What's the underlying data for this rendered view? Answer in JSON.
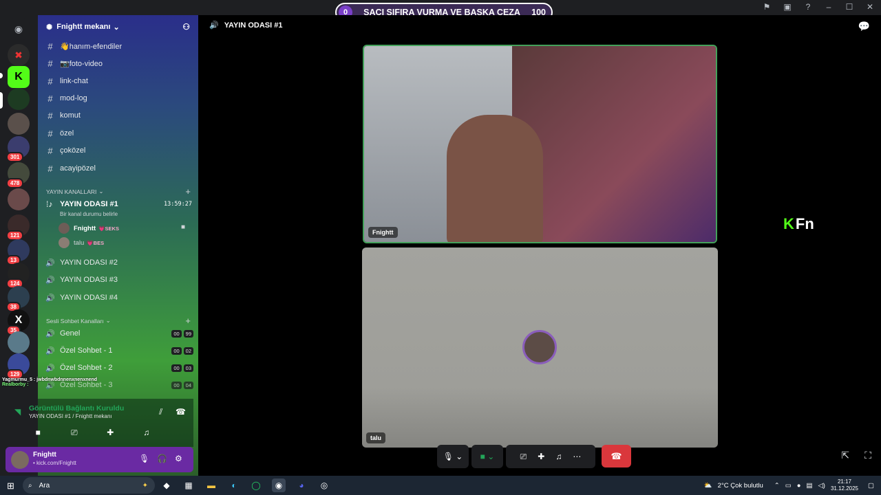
{
  "window": {
    "title": "Fnightt mekanı"
  },
  "overlay": {
    "left_num": "0",
    "text": "SAÇI SIFIRA VURMA VE BAŞKA CEZA",
    "right_num": "100"
  },
  "server": {
    "name": "Fnightt mekanı"
  },
  "text_channels": [
    {
      "name": "👋hanım-efendiler"
    },
    {
      "name": "📷foto-video"
    },
    {
      "name": "link-chat"
    },
    {
      "name": "mod-log"
    },
    {
      "name": "komut"
    },
    {
      "name": "özel"
    },
    {
      "name": "çoközel"
    },
    {
      "name": "acayipözel"
    }
  ],
  "categories": {
    "yayin": "YAYIN KANALLARI",
    "sesli": "Sesli Sohbet Kanalları"
  },
  "active_voice": {
    "name": "YAYIN ODASI #1",
    "time": "13:59:27",
    "status": "Bir kanal durumu belirle",
    "members": [
      {
        "name": "Fnightt",
        "status": "💗SEKS"
      },
      {
        "name": "talu",
        "status": "💗BES"
      }
    ]
  },
  "voice_channels": [
    {
      "name": "YAYIN ODASI #2"
    },
    {
      "name": "YAYIN ODASI #3"
    },
    {
      "name": "YAYIN ODASI #4"
    }
  ],
  "sesli_channels": [
    {
      "name": "Genel",
      "a": "00",
      "b": "99"
    },
    {
      "name": "Özel Sohbet - 1",
      "a": "00",
      "b": "02"
    },
    {
      "name": "Özel Sohbet - 2",
      "a": "00",
      "b": "03"
    },
    {
      "name": "Özel Sohbet - 3",
      "a": "00",
      "b": "04"
    }
  ],
  "chat_overlay": {
    "line1": "Yagmurmu_5 : jwbdnwbdnnenxnenxnend",
    "line2": "Realborby :"
  },
  "guild_badges": [
    "301",
    "478",
    "121",
    "13",
    "124",
    "38",
    "35",
    "129"
  ],
  "voice_panel": {
    "title": "Görüntülü Bağlantı Kuruldu",
    "sub": "YAYIN ODASI #1 / Fnightt mekanı"
  },
  "user": {
    "name": "Fnightt",
    "sub": "• kick.com/Fnightt"
  },
  "main": {
    "channel_title": "YAYIN ODASI #1"
  },
  "tiles": {
    "tile1_label": "Fnightt",
    "tile2_label": "talu"
  },
  "watermark": {
    "text": "Fn"
  },
  "taskbar": {
    "search": "Ara",
    "weather": "2°C  Çok bulutlu",
    "time": "21:17",
    "date": "31.12.2025"
  },
  "colors": {
    "accent_green": "#23a559",
    "hangup": "#da373c",
    "user_panel": "#6a2aa3"
  }
}
